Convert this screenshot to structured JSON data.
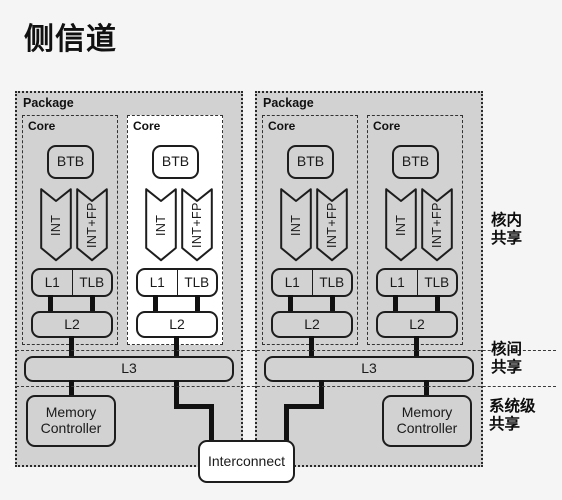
{
  "page": {
    "title": "侧信道",
    "background": "#f5f5f5"
  },
  "colors": {
    "package_fill": "#d2d2d2",
    "box_fill": "#d2d2d2",
    "highlight_fill": "#ffffff",
    "stroke": "#1d1d1d",
    "text": "#1a1a1a"
  },
  "packages": [
    {
      "label": "Package",
      "cores": [
        {
          "label": "Core",
          "highlighted": false,
          "btb": "BTB",
          "exec_units": [
            "INT",
            "INT+FP"
          ],
          "l1": "L1",
          "tlb": "TLB",
          "l2": "L2"
        },
        {
          "label": "Core",
          "highlighted": true,
          "btb": "BTB",
          "exec_units": [
            "INT",
            "INT+FP"
          ],
          "l1": "L1",
          "tlb": "TLB",
          "l2": "L2"
        }
      ],
      "l3": "L3",
      "memory_controller": "Memory\nController",
      "memory_controller_line1": "Memory",
      "memory_controller_line2": "Controller"
    },
    {
      "label": "Package",
      "cores": [
        {
          "label": "Core",
          "highlighted": false,
          "btb": "BTB",
          "exec_units": [
            "INT",
            "INT+FP"
          ],
          "l1": "L1",
          "tlb": "TLB",
          "l2": "L2"
        },
        {
          "label": "Core",
          "highlighted": false,
          "btb": "BTB",
          "exec_units": [
            "INT",
            "INT+FP"
          ],
          "l1": "L1",
          "tlb": "TLB",
          "l2": "L2"
        }
      ],
      "l3": "L3",
      "memory_controller_line1": "Memory",
      "memory_controller_line2": "Controller"
    }
  ],
  "interconnect": {
    "label": "Interconnect"
  },
  "sharing_levels": [
    {
      "line1": "核内",
      "line2": "共享"
    },
    {
      "line1": "核间",
      "line2": "共享"
    },
    {
      "line1": "系统级",
      "line2": "共享"
    }
  ]
}
